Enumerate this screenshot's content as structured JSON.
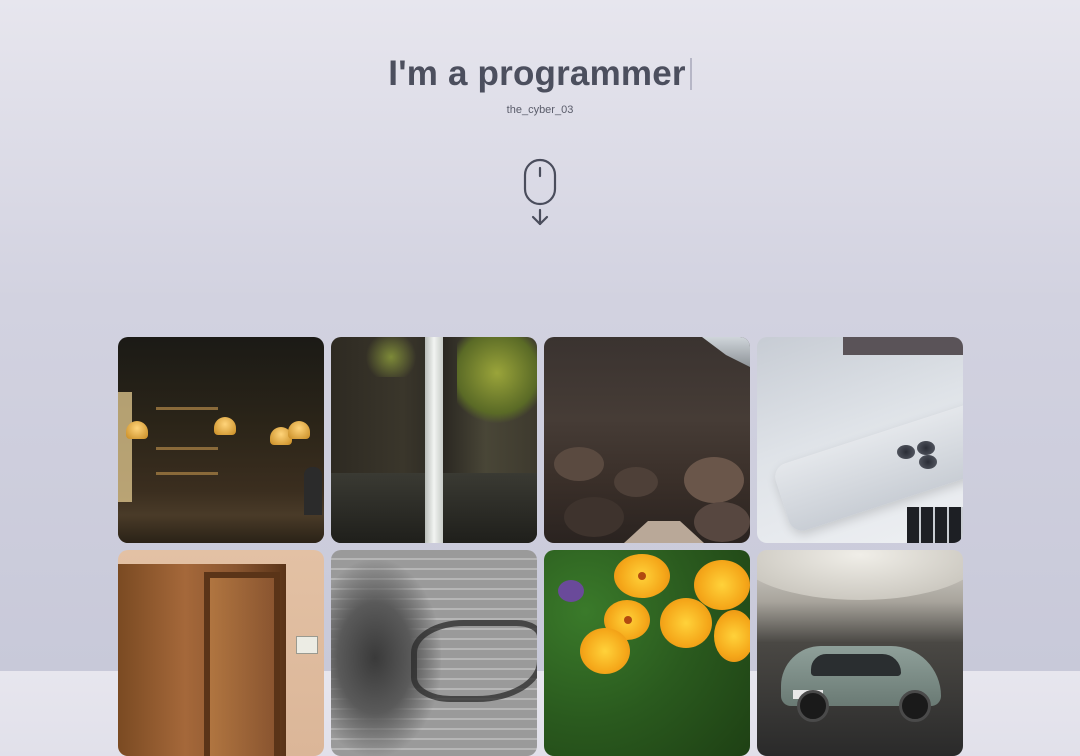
{
  "hero": {
    "title": "I'm a programmer",
    "subtitle": "the_cyber_03",
    "scroll_icon": "mouse-scroll-down-icon"
  },
  "gallery": {
    "tiles": [
      {
        "subject": "bar-interior"
      },
      {
        "subject": "waterfall"
      },
      {
        "subject": "rocky-canyon"
      },
      {
        "subject": "phone-on-laptop"
      },
      {
        "subject": "wooden-door"
      },
      {
        "subject": "graffiti-wall"
      },
      {
        "subject": "yellow-flowers"
      },
      {
        "subject": "car-in-garage"
      }
    ]
  },
  "colors": {
    "title": "#4c4f5e",
    "background_top": "#e7e6ee",
    "background_bottom": "#c8c9d9"
  }
}
